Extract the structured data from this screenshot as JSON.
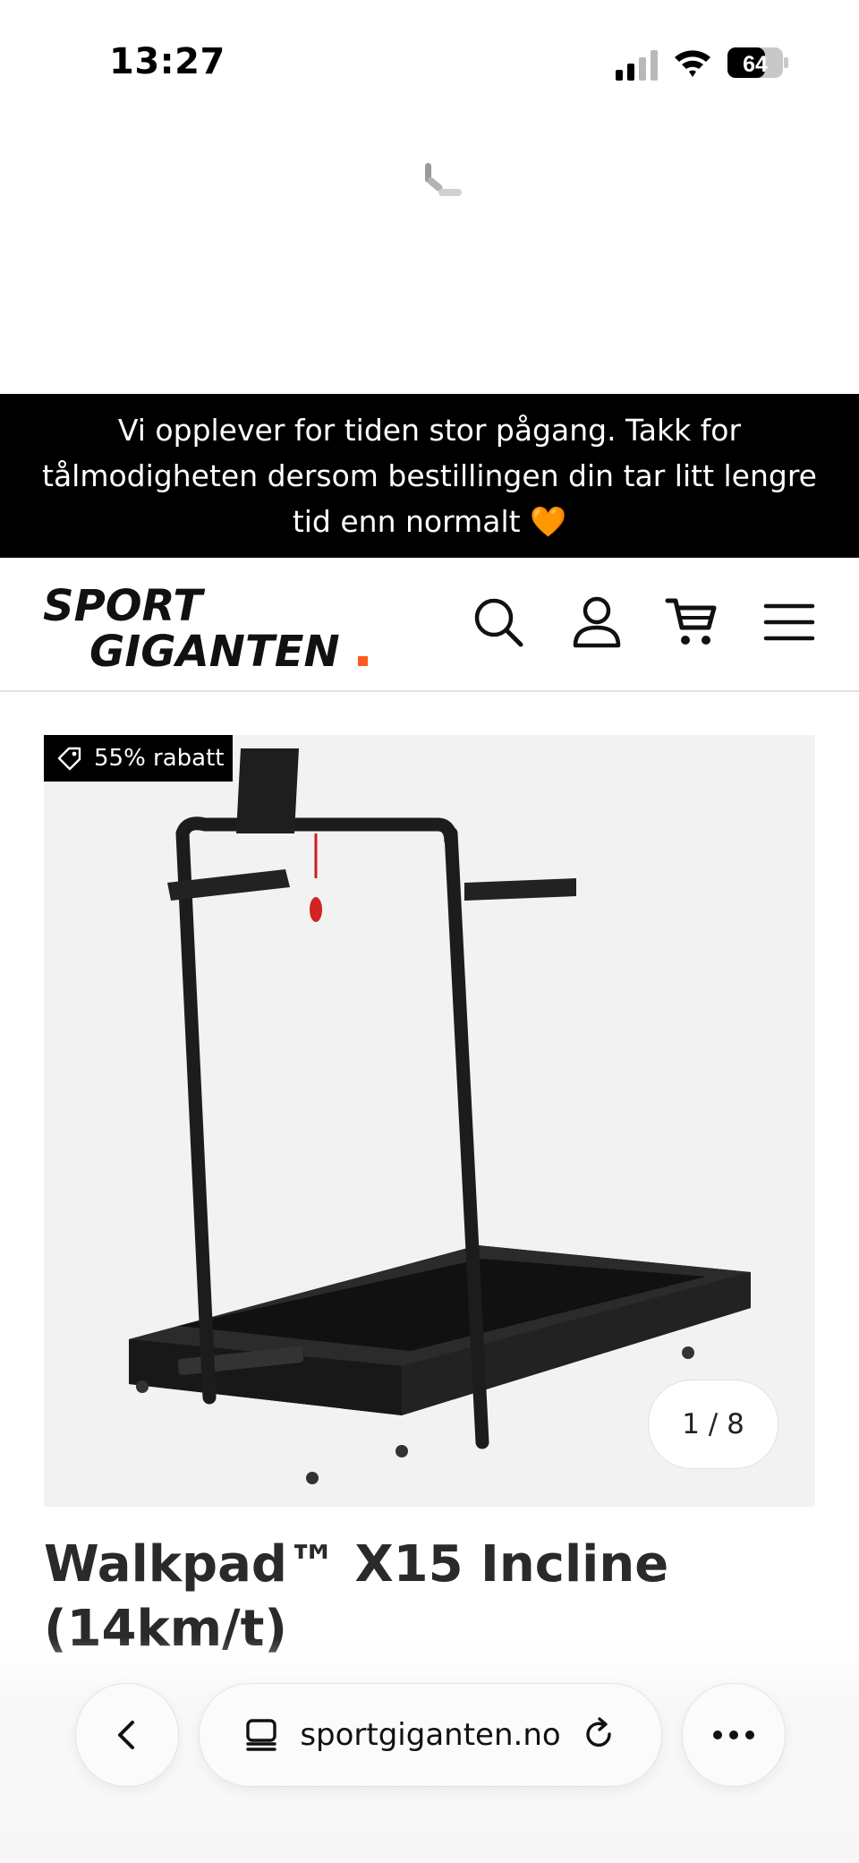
{
  "status_bar": {
    "time": "13:27",
    "battery": "64",
    "icons": [
      "signal-icon",
      "wifi-icon",
      "battery-icon"
    ]
  },
  "loading": {
    "icon": "loading-spinner-icon"
  },
  "announcement": {
    "text": "Vi opplever for tiden stor pågang. Takk for tålmodigheten dersom bestillingen din tar litt lengre tid enn normalt 🧡"
  },
  "header": {
    "logo_line1": "SPORT",
    "logo_line2": "GIGANTEN",
    "logo_dot_color": "#ff5a1f",
    "icons": [
      "search-icon",
      "account-icon",
      "cart-icon",
      "menu-icon"
    ]
  },
  "product": {
    "discount_label": "55% rabatt",
    "image_counter": "1 / 8",
    "title": "Walkpad™ X15 Incline (14km/t)"
  },
  "browser": {
    "url": "sportgiganten.no",
    "icons": [
      "back-icon",
      "tabs-icon",
      "reload-icon",
      "more-icon"
    ]
  }
}
